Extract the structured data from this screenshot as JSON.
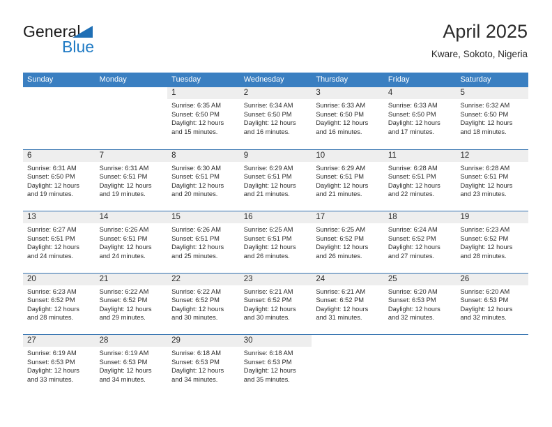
{
  "brand": {
    "word1": "General",
    "word2": "Blue",
    "triangle_color": "#1f6fb5",
    "blue_color": "#1f7ac4"
  },
  "header": {
    "title": "April 2025",
    "subtitle": "Kware, Sokoto, Nigeria"
  },
  "theme": {
    "header_bar": "#3a7fc1",
    "week_divider": "#2f6fae",
    "day_number_band": "#eeeeee"
  },
  "weekdays": [
    "Sunday",
    "Monday",
    "Tuesday",
    "Wednesday",
    "Thursday",
    "Friday",
    "Saturday"
  ],
  "weeks": [
    [
      {
        "day": "",
        "sunrise": "",
        "sunset": "",
        "daylight_line1": "",
        "daylight_line2": ""
      },
      {
        "day": "",
        "sunrise": "",
        "sunset": "",
        "daylight_line1": "",
        "daylight_line2": ""
      },
      {
        "day": "1",
        "sunrise": "Sunrise: 6:35 AM",
        "sunset": "Sunset: 6:50 PM",
        "daylight_line1": "Daylight: 12 hours",
        "daylight_line2": "and 15 minutes."
      },
      {
        "day": "2",
        "sunrise": "Sunrise: 6:34 AM",
        "sunset": "Sunset: 6:50 PM",
        "daylight_line1": "Daylight: 12 hours",
        "daylight_line2": "and 16 minutes."
      },
      {
        "day": "3",
        "sunrise": "Sunrise: 6:33 AM",
        "sunset": "Sunset: 6:50 PM",
        "daylight_line1": "Daylight: 12 hours",
        "daylight_line2": "and 16 minutes."
      },
      {
        "day": "4",
        "sunrise": "Sunrise: 6:33 AM",
        "sunset": "Sunset: 6:50 PM",
        "daylight_line1": "Daylight: 12 hours",
        "daylight_line2": "and 17 minutes."
      },
      {
        "day": "5",
        "sunrise": "Sunrise: 6:32 AM",
        "sunset": "Sunset: 6:50 PM",
        "daylight_line1": "Daylight: 12 hours",
        "daylight_line2": "and 18 minutes."
      }
    ],
    [
      {
        "day": "6",
        "sunrise": "Sunrise: 6:31 AM",
        "sunset": "Sunset: 6:50 PM",
        "daylight_line1": "Daylight: 12 hours",
        "daylight_line2": "and 19 minutes."
      },
      {
        "day": "7",
        "sunrise": "Sunrise: 6:31 AM",
        "sunset": "Sunset: 6:51 PM",
        "daylight_line1": "Daylight: 12 hours",
        "daylight_line2": "and 19 minutes."
      },
      {
        "day": "8",
        "sunrise": "Sunrise: 6:30 AM",
        "sunset": "Sunset: 6:51 PM",
        "daylight_line1": "Daylight: 12 hours",
        "daylight_line2": "and 20 minutes."
      },
      {
        "day": "9",
        "sunrise": "Sunrise: 6:29 AM",
        "sunset": "Sunset: 6:51 PM",
        "daylight_line1": "Daylight: 12 hours",
        "daylight_line2": "and 21 minutes."
      },
      {
        "day": "10",
        "sunrise": "Sunrise: 6:29 AM",
        "sunset": "Sunset: 6:51 PM",
        "daylight_line1": "Daylight: 12 hours",
        "daylight_line2": "and 21 minutes."
      },
      {
        "day": "11",
        "sunrise": "Sunrise: 6:28 AM",
        "sunset": "Sunset: 6:51 PM",
        "daylight_line1": "Daylight: 12 hours",
        "daylight_line2": "and 22 minutes."
      },
      {
        "day": "12",
        "sunrise": "Sunrise: 6:28 AM",
        "sunset": "Sunset: 6:51 PM",
        "daylight_line1": "Daylight: 12 hours",
        "daylight_line2": "and 23 minutes."
      }
    ],
    [
      {
        "day": "13",
        "sunrise": "Sunrise: 6:27 AM",
        "sunset": "Sunset: 6:51 PM",
        "daylight_line1": "Daylight: 12 hours",
        "daylight_line2": "and 24 minutes."
      },
      {
        "day": "14",
        "sunrise": "Sunrise: 6:26 AM",
        "sunset": "Sunset: 6:51 PM",
        "daylight_line1": "Daylight: 12 hours",
        "daylight_line2": "and 24 minutes."
      },
      {
        "day": "15",
        "sunrise": "Sunrise: 6:26 AM",
        "sunset": "Sunset: 6:51 PM",
        "daylight_line1": "Daylight: 12 hours",
        "daylight_line2": "and 25 minutes."
      },
      {
        "day": "16",
        "sunrise": "Sunrise: 6:25 AM",
        "sunset": "Sunset: 6:51 PM",
        "daylight_line1": "Daylight: 12 hours",
        "daylight_line2": "and 26 minutes."
      },
      {
        "day": "17",
        "sunrise": "Sunrise: 6:25 AM",
        "sunset": "Sunset: 6:52 PM",
        "daylight_line1": "Daylight: 12 hours",
        "daylight_line2": "and 26 minutes."
      },
      {
        "day": "18",
        "sunrise": "Sunrise: 6:24 AM",
        "sunset": "Sunset: 6:52 PM",
        "daylight_line1": "Daylight: 12 hours",
        "daylight_line2": "and 27 minutes."
      },
      {
        "day": "19",
        "sunrise": "Sunrise: 6:23 AM",
        "sunset": "Sunset: 6:52 PM",
        "daylight_line1": "Daylight: 12 hours",
        "daylight_line2": "and 28 minutes."
      }
    ],
    [
      {
        "day": "20",
        "sunrise": "Sunrise: 6:23 AM",
        "sunset": "Sunset: 6:52 PM",
        "daylight_line1": "Daylight: 12 hours",
        "daylight_line2": "and 28 minutes."
      },
      {
        "day": "21",
        "sunrise": "Sunrise: 6:22 AM",
        "sunset": "Sunset: 6:52 PM",
        "daylight_line1": "Daylight: 12 hours",
        "daylight_line2": "and 29 minutes."
      },
      {
        "day": "22",
        "sunrise": "Sunrise: 6:22 AM",
        "sunset": "Sunset: 6:52 PM",
        "daylight_line1": "Daylight: 12 hours",
        "daylight_line2": "and 30 minutes."
      },
      {
        "day": "23",
        "sunrise": "Sunrise: 6:21 AM",
        "sunset": "Sunset: 6:52 PM",
        "daylight_line1": "Daylight: 12 hours",
        "daylight_line2": "and 30 minutes."
      },
      {
        "day": "24",
        "sunrise": "Sunrise: 6:21 AM",
        "sunset": "Sunset: 6:52 PM",
        "daylight_line1": "Daylight: 12 hours",
        "daylight_line2": "and 31 minutes."
      },
      {
        "day": "25",
        "sunrise": "Sunrise: 6:20 AM",
        "sunset": "Sunset: 6:53 PM",
        "daylight_line1": "Daylight: 12 hours",
        "daylight_line2": "and 32 minutes."
      },
      {
        "day": "26",
        "sunrise": "Sunrise: 6:20 AM",
        "sunset": "Sunset: 6:53 PM",
        "daylight_line1": "Daylight: 12 hours",
        "daylight_line2": "and 32 minutes."
      }
    ],
    [
      {
        "day": "27",
        "sunrise": "Sunrise: 6:19 AM",
        "sunset": "Sunset: 6:53 PM",
        "daylight_line1": "Daylight: 12 hours",
        "daylight_line2": "and 33 minutes."
      },
      {
        "day": "28",
        "sunrise": "Sunrise: 6:19 AM",
        "sunset": "Sunset: 6:53 PM",
        "daylight_line1": "Daylight: 12 hours",
        "daylight_line2": "and 34 minutes."
      },
      {
        "day": "29",
        "sunrise": "Sunrise: 6:18 AM",
        "sunset": "Sunset: 6:53 PM",
        "daylight_line1": "Daylight: 12 hours",
        "daylight_line2": "and 34 minutes."
      },
      {
        "day": "30",
        "sunrise": "Sunrise: 6:18 AM",
        "sunset": "Sunset: 6:53 PM",
        "daylight_line1": "Daylight: 12 hours",
        "daylight_line2": "and 35 minutes."
      },
      {
        "day": "",
        "sunrise": "",
        "sunset": "",
        "daylight_line1": "",
        "daylight_line2": ""
      },
      {
        "day": "",
        "sunrise": "",
        "sunset": "",
        "daylight_line1": "",
        "daylight_line2": ""
      },
      {
        "day": "",
        "sunrise": "",
        "sunset": "",
        "daylight_line1": "",
        "daylight_line2": ""
      }
    ]
  ]
}
